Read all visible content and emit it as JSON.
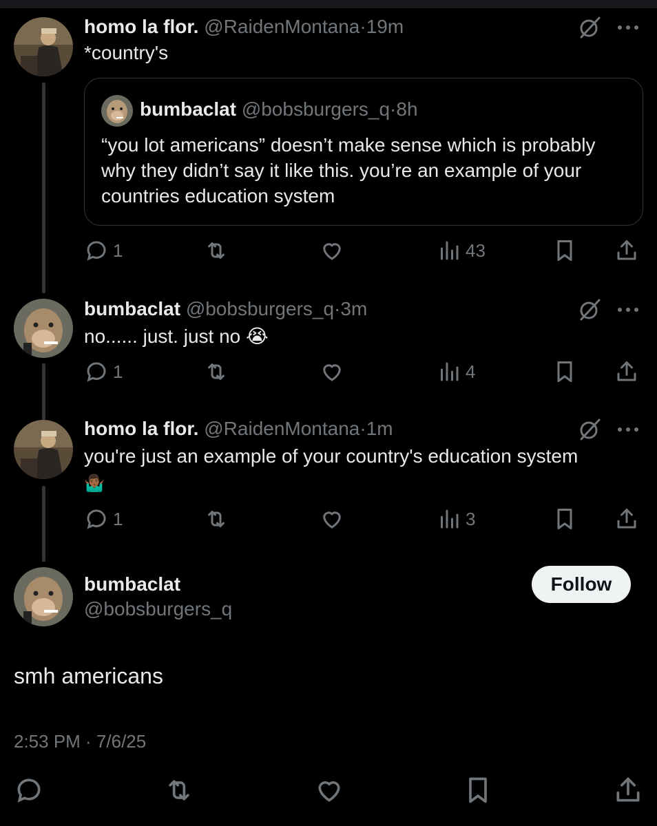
{
  "tweets": [
    {
      "name": "homo la flor.",
      "handle": "@RaidenMontana",
      "separator": "·",
      "time": "19m",
      "text": "*country's",
      "quote": {
        "name": "bumbaclat",
        "handle": "@bobsburgers_q",
        "separator": "·",
        "time": "8h",
        "text": "“you lot americans” doesn’t make sense which is probably why they didn’t say it like this. you’re an example of your countries education system"
      },
      "replies": "1",
      "views": "43"
    },
    {
      "name": "bumbaclat",
      "handle": "@bobsburgers_q",
      "separator": "·",
      "time": "3m",
      "text": "no...... just. just no 😭",
      "replies": "1",
      "views": "4"
    },
    {
      "name": "homo la flor.",
      "handle": "@RaidenMontana",
      "separator": "·",
      "time": "1m",
      "text": "you're just an example of your country's education system",
      "emoji": "🤷🏾‍♂️",
      "replies": "1",
      "views": "3"
    }
  ],
  "main_tweet": {
    "name": "bumbaclat",
    "handle": "@bobsburgers_q",
    "follow_label": "Follow",
    "text": "smh americans",
    "timestamp": "2:53 PM · 7/6/25"
  },
  "icons": {
    "reply": "reply-icon",
    "retweet": "retweet-icon",
    "like": "heart-icon",
    "views": "views-icon",
    "bookmark": "bookmark-icon",
    "share": "share-icon",
    "grok": "grok-icon",
    "more": "more-icon"
  },
  "colors": {
    "background": "#000000",
    "text": "#e7e9ea",
    "muted": "#71767b",
    "border": "#2f3336",
    "follow_bg": "#eff3f4"
  }
}
